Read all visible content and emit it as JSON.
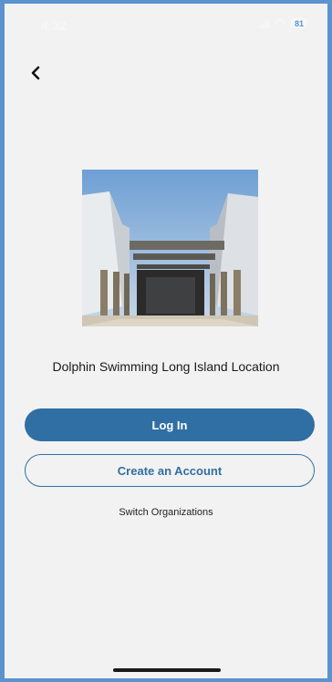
{
  "status_bar": {
    "time": "4:32",
    "battery": "81"
  },
  "icons": {
    "back": "chevron-left-icon",
    "signal": "signal-icon",
    "wifi": "wifi-icon",
    "battery": "battery-icon"
  },
  "location": {
    "name": "Dolphin Swimming Long Island Location"
  },
  "actions": {
    "login_label": "Log In",
    "create_label": "Create an Account",
    "switch_label": "Switch Organizations"
  },
  "colors": {
    "accent": "#2f6fa3",
    "background": "#f2f2f2",
    "frame": "#5b93cf"
  }
}
